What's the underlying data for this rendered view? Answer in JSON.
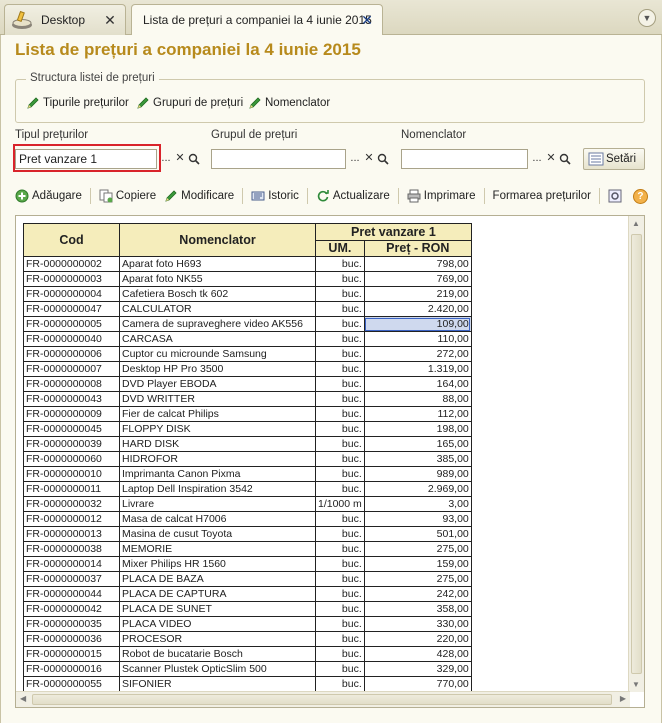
{
  "tabs": {
    "desktop_label": "Desktop",
    "active_label": "Lista de prețuri a companiei la 4 iunie 2015"
  },
  "page": {
    "title": "Lista de prețuri a companiei la 4 iunie 2015"
  },
  "structure": {
    "title": "Structura listei de prețuri",
    "links": [
      "Tipurile prețurilor",
      "Grupuri de prețuri",
      "Nomenclator"
    ]
  },
  "filters": {
    "price_type_label": "Tipul prețurilor",
    "price_type_value": "Pret vanzare 1",
    "price_group_label": "Grupul de prețuri",
    "price_group_value": "",
    "nomenclator_label": "Nomenclator",
    "nomenclator_value": "",
    "dots": "...",
    "clear": "✕",
    "settings_label": "Setări"
  },
  "toolbar": {
    "add": "Adăugare",
    "copy": "Copiere",
    "edit": "Modificare",
    "history": "Istoric",
    "refresh": "Actualizare",
    "print": "Imprimare",
    "build": "Formarea prețurilor",
    "help": "?"
  },
  "table": {
    "header_cod": "Cod",
    "header_nomenclator": "Nomenclator",
    "header_group": "Pret vanzare 1",
    "header_um": "UM.",
    "header_pret": "Preț - RON",
    "rows": [
      {
        "cod": "FR-0000000002",
        "nom": "Aparat foto H693",
        "um": "buc.",
        "pret": "798,00"
      },
      {
        "cod": "FR-0000000003",
        "nom": "Aparat foto NK55",
        "um": "buc.",
        "pret": "769,00"
      },
      {
        "cod": "FR-0000000004",
        "nom": "Cafetiera Bosch tk 602",
        "um": "buc.",
        "pret": "219,00"
      },
      {
        "cod": "FR-0000000047",
        "nom": "CALCULATOR",
        "um": "buc.",
        "pret": "2.420,00"
      },
      {
        "cod": "FR-0000000005",
        "nom": "Camera de supraveghere video AK556",
        "um": "buc.",
        "pret": "109,00"
      },
      {
        "cod": "FR-0000000040",
        "nom": "CARCASA",
        "um": "buc.",
        "pret": "110,00"
      },
      {
        "cod": "FR-0000000006",
        "nom": "Cuptor cu microunde Samsung",
        "um": "buc.",
        "pret": "272,00"
      },
      {
        "cod": "FR-0000000007",
        "nom": "Desktop HP Pro 3500",
        "um": "buc.",
        "pret": "1.319,00"
      },
      {
        "cod": "FR-0000000008",
        "nom": "DVD Player EBODA",
        "um": "buc.",
        "pret": "164,00"
      },
      {
        "cod": "FR-0000000043",
        "nom": "DVD WRITTER",
        "um": "buc.",
        "pret": "88,00"
      },
      {
        "cod": "FR-0000000009",
        "nom": "Fier de calcat Philips",
        "um": "buc.",
        "pret": "112,00"
      },
      {
        "cod": "FR-0000000045",
        "nom": "FLOPPY DISK",
        "um": "buc.",
        "pret": "198,00"
      },
      {
        "cod": "FR-0000000039",
        "nom": "HARD DISK",
        "um": "buc.",
        "pret": "165,00"
      },
      {
        "cod": "FR-0000000060",
        "nom": "HIDROFOR",
        "um": "buc.",
        "pret": "385,00"
      },
      {
        "cod": "FR-0000000010",
        "nom": "Imprimanta Canon Pixma",
        "um": "buc.",
        "pret": "989,00"
      },
      {
        "cod": "FR-0000000011",
        "nom": "Laptop Dell Inspiration 3542",
        "um": "buc.",
        "pret": "2.969,00"
      },
      {
        "cod": "FR-0000000032",
        "nom": "Livrare",
        "um": "1/1000 m",
        "pret": "3,00"
      },
      {
        "cod": "FR-0000000012",
        "nom": "Masa de calcat H7006",
        "um": "buc.",
        "pret": "93,00"
      },
      {
        "cod": "FR-0000000013",
        "nom": "Masina de cusut Toyota",
        "um": "buc.",
        "pret": "501,00"
      },
      {
        "cod": "FR-0000000038",
        "nom": "MEMORIE",
        "um": "buc.",
        "pret": "275,00"
      },
      {
        "cod": "FR-0000000014",
        "nom": "Mixer Philips HR 1560",
        "um": "buc.",
        "pret": "159,00"
      },
      {
        "cod": "FR-0000000037",
        "nom": "PLACA DE BAZA",
        "um": "buc.",
        "pret": "275,00"
      },
      {
        "cod": "FR-0000000044",
        "nom": "PLACA DE CAPTURA",
        "um": "buc.",
        "pret": "242,00"
      },
      {
        "cod": "FR-0000000042",
        "nom": "PLACA DE SUNET",
        "um": "buc.",
        "pret": "358,00"
      },
      {
        "cod": "FR-0000000035",
        "nom": "PLACA VIDEO",
        "um": "buc.",
        "pret": "330,00"
      },
      {
        "cod": "FR-0000000036",
        "nom": "PROCESOR",
        "um": "buc.",
        "pret": "220,00"
      },
      {
        "cod": "FR-0000000015",
        "nom": "Robot de bucatarie Bosch",
        "um": "buc.",
        "pret": "428,00"
      },
      {
        "cod": "FR-0000000016",
        "nom": "Scanner Plustek OpticSlim 500",
        "um": "buc.",
        "pret": "329,00"
      },
      {
        "cod": "FR-0000000055",
        "nom": "SIFONIER",
        "um": "buc.",
        "pret": "770,00"
      }
    ],
    "selected_row": 4
  },
  "colors": {
    "title": "#b78a1c",
    "header_bg": "#f5edbb",
    "highlight": "#d9232b",
    "pencil": "#3c9a3c"
  }
}
